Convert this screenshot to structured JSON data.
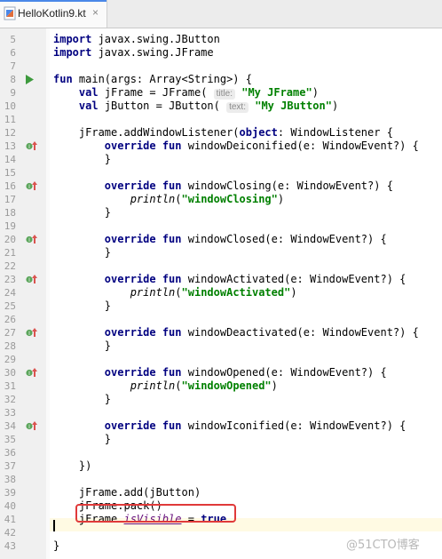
{
  "tab": {
    "filename": "HelloKotlin9.kt",
    "close_glyph": "×"
  },
  "colors": {
    "keyword": "#000080",
    "string": "#008000",
    "property": "#660e7a",
    "highlight": "#e03a3a",
    "run": "#3d9a3d"
  },
  "watermark": "@51CTO博客",
  "lines": [
    {
      "n": "5",
      "tokens": [
        {
          "t": "import",
          "c": "kw"
        },
        {
          "t": " javax.swing.JButton"
        }
      ]
    },
    {
      "n": "6",
      "tokens": [
        {
          "t": "import",
          "c": "kw"
        },
        {
          "t": " javax.swing.JFrame"
        }
      ]
    },
    {
      "n": "7",
      "tokens": []
    },
    {
      "n": "8",
      "icon": "run-arrow-icon",
      "tokens": [
        {
          "t": "fun",
          "c": "kw"
        },
        {
          "t": " main(args: Array<String>) {"
        }
      ]
    },
    {
      "n": "9",
      "tokens": [
        {
          "t": "    "
        },
        {
          "t": "val",
          "c": "kw"
        },
        {
          "t": " jFrame = JFrame( "
        },
        {
          "t": "title:",
          "c": "hint"
        },
        {
          "t": " "
        },
        {
          "t": "\"My JFrame\"",
          "c": "str"
        },
        {
          "t": ")"
        }
      ]
    },
    {
      "n": "10",
      "tokens": [
        {
          "t": "    "
        },
        {
          "t": "val",
          "c": "kw"
        },
        {
          "t": " jButton = JButton( "
        },
        {
          "t": "text:",
          "c": "hint"
        },
        {
          "t": " "
        },
        {
          "t": "\"My JButton\"",
          "c": "str"
        },
        {
          "t": ")"
        }
      ]
    },
    {
      "n": "11",
      "tokens": []
    },
    {
      "n": "12",
      "tokens": [
        {
          "t": "    jFrame.addWindowListener("
        },
        {
          "t": "object",
          "c": "kw"
        },
        {
          "t": ": WindowListener {"
        }
      ]
    },
    {
      "n": "13",
      "icon": "implements-icon",
      "tokens": [
        {
          "t": "        "
        },
        {
          "t": "override fun",
          "c": "kw"
        },
        {
          "t": " windowDeiconified(e: WindowEvent?) {"
        }
      ]
    },
    {
      "n": "14",
      "tokens": [
        {
          "t": "        }"
        }
      ]
    },
    {
      "n": "15",
      "tokens": []
    },
    {
      "n": "16",
      "icon": "implements-icon",
      "tokens": [
        {
          "t": "        "
        },
        {
          "t": "override fun",
          "c": "kw"
        },
        {
          "t": " windowClosing(e: WindowEvent?) {"
        }
      ]
    },
    {
      "n": "17",
      "tokens": [
        {
          "t": "            "
        },
        {
          "t": "println",
          "c": "fn"
        },
        {
          "t": "("
        },
        {
          "t": "\"windowClosing\"",
          "c": "str"
        },
        {
          "t": ")"
        }
      ]
    },
    {
      "n": "18",
      "tokens": [
        {
          "t": "        }"
        }
      ]
    },
    {
      "n": "19",
      "tokens": []
    },
    {
      "n": "20",
      "icon": "implements-icon",
      "tokens": [
        {
          "t": "        "
        },
        {
          "t": "override fun",
          "c": "kw"
        },
        {
          "t": " windowClosed(e: WindowEvent?) {"
        }
      ]
    },
    {
      "n": "21",
      "tokens": [
        {
          "t": "        }"
        }
      ]
    },
    {
      "n": "22",
      "tokens": []
    },
    {
      "n": "23",
      "icon": "implements-icon",
      "tokens": [
        {
          "t": "        "
        },
        {
          "t": "override fun",
          "c": "kw"
        },
        {
          "t": " windowActivated(e: WindowEvent?) {"
        }
      ]
    },
    {
      "n": "24",
      "tokens": [
        {
          "t": "            "
        },
        {
          "t": "println",
          "c": "fn"
        },
        {
          "t": "("
        },
        {
          "t": "\"windowActivated\"",
          "c": "str"
        },
        {
          "t": ")"
        }
      ]
    },
    {
      "n": "25",
      "tokens": [
        {
          "t": "        }"
        }
      ]
    },
    {
      "n": "26",
      "tokens": []
    },
    {
      "n": "27",
      "icon": "implements-icon",
      "tokens": [
        {
          "t": "        "
        },
        {
          "t": "override fun",
          "c": "kw"
        },
        {
          "t": " windowDeactivated(e: WindowEvent?) {"
        }
      ]
    },
    {
      "n": "28",
      "tokens": [
        {
          "t": "        }"
        }
      ]
    },
    {
      "n": "29",
      "tokens": []
    },
    {
      "n": "30",
      "icon": "implements-icon",
      "tokens": [
        {
          "t": "        "
        },
        {
          "t": "override fun",
          "c": "kw"
        },
        {
          "t": " windowOpened(e: WindowEvent?) {"
        }
      ]
    },
    {
      "n": "31",
      "tokens": [
        {
          "t": "            "
        },
        {
          "t": "println",
          "c": "fn"
        },
        {
          "t": "("
        },
        {
          "t": "\"windowOpened\"",
          "c": "str"
        },
        {
          "t": ")"
        }
      ]
    },
    {
      "n": "32",
      "tokens": [
        {
          "t": "        }"
        }
      ]
    },
    {
      "n": "33",
      "tokens": []
    },
    {
      "n": "34",
      "icon": "implements-icon",
      "tokens": [
        {
          "t": "        "
        },
        {
          "t": "override fun",
          "c": "kw"
        },
        {
          "t": " windowIconified(e: WindowEvent?) {"
        }
      ]
    },
    {
      "n": "35",
      "tokens": [
        {
          "t": "        }"
        }
      ]
    },
    {
      "n": "36",
      "tokens": []
    },
    {
      "n": "37",
      "tokens": [
        {
          "t": "    })"
        }
      ]
    },
    {
      "n": "38",
      "tokens": []
    },
    {
      "n": "39",
      "tokens": [
        {
          "t": "    jFrame.add(jButton)"
        }
      ]
    },
    {
      "n": "40",
      "tokens": [
        {
          "t": "    jFrame.pack()"
        }
      ]
    },
    {
      "n": "41",
      "tokens": [
        {
          "t": "    jFrame."
        },
        {
          "t": "isVisible",
          "c": "prop"
        },
        {
          "t": " = "
        },
        {
          "t": "true",
          "c": "kw"
        }
      ]
    },
    {
      "n": "42",
      "tokens": []
    },
    {
      "n": "43",
      "tokens": [
        {
          "t": "}"
        }
      ]
    }
  ]
}
